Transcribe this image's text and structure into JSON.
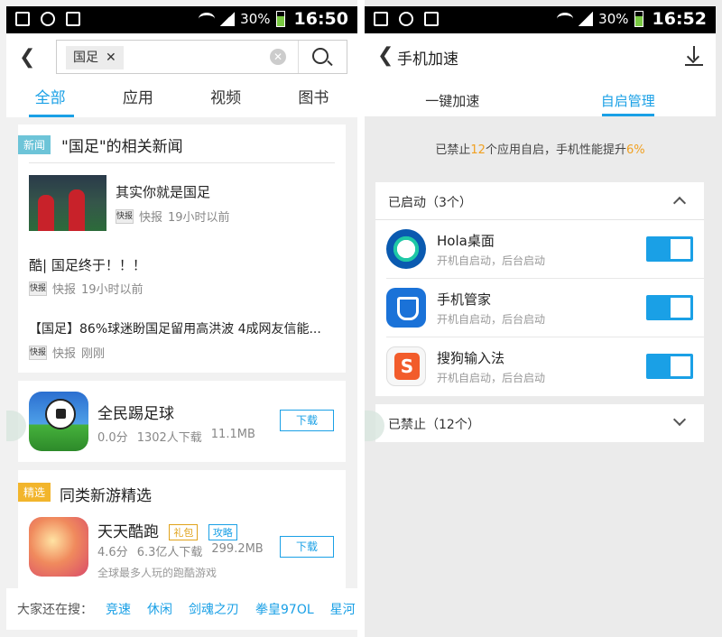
{
  "left": {
    "status": {
      "battery": "30%",
      "time": "16:50"
    },
    "search": {
      "query": "国足"
    },
    "tabs": [
      "全部",
      "应用",
      "视频",
      "图书"
    ],
    "news": {
      "tag": "新闻",
      "title": "\"国足\"的相关新闻",
      "items": [
        {
          "headline": "其实你就是国足",
          "source": "快报",
          "time": "19小时以前"
        },
        {
          "headline": "酷| 国足终于！！！",
          "source": "快报",
          "time": "19小时以前"
        },
        {
          "headline": "【国足】86%球迷盼国足留用高洪波 4成网友信能...",
          "source": "快报",
          "time": "刚刚"
        }
      ]
    },
    "app1": {
      "name": "全民踢足球",
      "score": "0.0分",
      "downloads": "1302人下载",
      "size": "11.1MB",
      "button": "下载"
    },
    "featured": {
      "tag": "精选",
      "title": "同类新游精选",
      "app": {
        "name": "天天酷跑",
        "badge_gift": "礼包",
        "badge_guide": "攻略",
        "score": "4.6分",
        "downloads": "6.3亿人下载",
        "size": "299.2MB",
        "desc": "全球最多人玩的跑酷游戏",
        "button": "下载"
      }
    },
    "bottom": {
      "label": "大家还在搜：",
      "links": [
        "竞速",
        "休闲",
        "剑魂之刃",
        "拳皇97OL",
        "星河"
      ]
    }
  },
  "right": {
    "status": {
      "battery": "30%",
      "time": "16:52"
    },
    "title": "手机加速",
    "tabs": [
      "一键加速",
      "自启管理"
    ],
    "summary": {
      "prefix": "已禁止",
      "count": "12",
      "middle": "个应用自启，手机性能提升",
      "percent": "6%"
    },
    "enabled_section": "已启动（3个）",
    "apps": [
      {
        "name": "Hola桌面",
        "sub": "开机自启动，后台启动"
      },
      {
        "name": "手机管家",
        "sub": "开机自启动，后台启动"
      },
      {
        "name": "搜狗输入法",
        "sub": "开机自启动，后台启动"
      }
    ],
    "disabled_section": "已禁止（12个）"
  },
  "colors": {
    "accent": "#1aa0e6",
    "highlight": "#f0a020"
  }
}
